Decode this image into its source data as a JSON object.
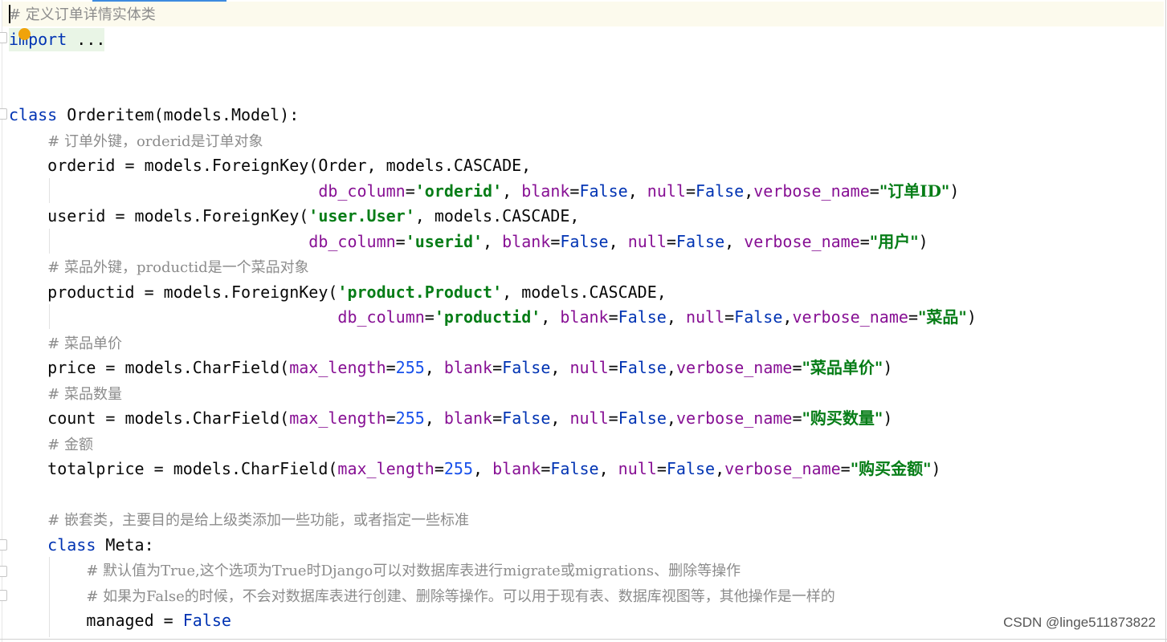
{
  "code": {
    "lines": [
      {
        "tokens": [
          {
            "t": "cmt",
            "v": "# 定义订单详情实体类"
          }
        ]
      },
      {
        "tokens": [
          {
            "t": "kw",
            "v": "import"
          },
          {
            "t": "txt",
            "v": " ..."
          }
        ]
      },
      {
        "tokens": []
      },
      {
        "tokens": []
      },
      {
        "tokens": [
          {
            "t": "kw",
            "v": "class"
          },
          {
            "t": "txt",
            "v": " Orderitem(models.Model):"
          }
        ]
      },
      {
        "tokens": [
          {
            "t": "txt",
            "v": "    "
          },
          {
            "t": "cmt",
            "v": "# 订单外键，orderid是订单对象"
          }
        ]
      },
      {
        "tokens": [
          {
            "t": "txt",
            "v": "    orderid = models.ForeignKey(Order, models.CASCADE,"
          }
        ]
      },
      {
        "tokens": [
          {
            "t": "txt",
            "v": "                                "
          },
          {
            "t": "param",
            "v": "db_column"
          },
          {
            "t": "txt",
            "v": "="
          },
          {
            "t": "str",
            "v": "'orderid'"
          },
          {
            "t": "txt",
            "v": ", "
          },
          {
            "t": "param",
            "v": "blank"
          },
          {
            "t": "txt",
            "v": "="
          },
          {
            "t": "kw",
            "v": "False"
          },
          {
            "t": "txt",
            "v": ", "
          },
          {
            "t": "param",
            "v": "null"
          },
          {
            "t": "txt",
            "v": "="
          },
          {
            "t": "kw",
            "v": "False"
          },
          {
            "t": "txt",
            "v": ","
          },
          {
            "t": "param",
            "v": "verbose_name"
          },
          {
            "t": "txt",
            "v": "="
          },
          {
            "t": "str",
            "v": "\"订单ID\""
          },
          {
            "t": "txt",
            "v": ")"
          }
        ]
      },
      {
        "tokens": [
          {
            "t": "txt",
            "v": "    userid = models.ForeignKey("
          },
          {
            "t": "str",
            "v": "'user.User'"
          },
          {
            "t": "txt",
            "v": ", models.CASCADE,"
          }
        ]
      },
      {
        "tokens": [
          {
            "t": "txt",
            "v": "                               "
          },
          {
            "t": "param",
            "v": "db_column"
          },
          {
            "t": "txt",
            "v": "="
          },
          {
            "t": "str",
            "v": "'userid'"
          },
          {
            "t": "txt",
            "v": ", "
          },
          {
            "t": "param",
            "v": "blank"
          },
          {
            "t": "txt",
            "v": "="
          },
          {
            "t": "kw",
            "v": "False"
          },
          {
            "t": "txt",
            "v": ", "
          },
          {
            "t": "param",
            "v": "null"
          },
          {
            "t": "txt",
            "v": "="
          },
          {
            "t": "kw",
            "v": "False"
          },
          {
            "t": "txt",
            "v": ", "
          },
          {
            "t": "param",
            "v": "verbose_name"
          },
          {
            "t": "txt",
            "v": "="
          },
          {
            "t": "str",
            "v": "\"用户\""
          },
          {
            "t": "txt",
            "v": ")"
          }
        ]
      },
      {
        "tokens": [
          {
            "t": "txt",
            "v": "    "
          },
          {
            "t": "cmt",
            "v": "# 菜品外键，productid是一个菜品对象"
          }
        ]
      },
      {
        "tokens": [
          {
            "t": "txt",
            "v": "    productid = models.ForeignKey("
          },
          {
            "t": "str",
            "v": "'product.Product'"
          },
          {
            "t": "txt",
            "v": ", models.CASCADE,"
          }
        ]
      },
      {
        "tokens": [
          {
            "t": "txt",
            "v": "                                  "
          },
          {
            "t": "param",
            "v": "db_column"
          },
          {
            "t": "txt",
            "v": "="
          },
          {
            "t": "str",
            "v": "'productid'"
          },
          {
            "t": "txt",
            "v": ", "
          },
          {
            "t": "param",
            "v": "blank"
          },
          {
            "t": "txt",
            "v": "="
          },
          {
            "t": "kw",
            "v": "False"
          },
          {
            "t": "txt",
            "v": ", "
          },
          {
            "t": "param",
            "v": "null"
          },
          {
            "t": "txt",
            "v": "="
          },
          {
            "t": "kw",
            "v": "False"
          },
          {
            "t": "txt",
            "v": ","
          },
          {
            "t": "param",
            "v": "verbose_name"
          },
          {
            "t": "txt",
            "v": "="
          },
          {
            "t": "str",
            "v": "\"菜品\""
          },
          {
            "t": "txt",
            "v": ")"
          }
        ]
      },
      {
        "tokens": [
          {
            "t": "txt",
            "v": "    "
          },
          {
            "t": "cmt",
            "v": "# 菜品单价"
          }
        ]
      },
      {
        "tokens": [
          {
            "t": "txt",
            "v": "    price = models.CharField("
          },
          {
            "t": "param",
            "v": "max_length"
          },
          {
            "t": "txt",
            "v": "="
          },
          {
            "t": "num",
            "v": "255"
          },
          {
            "t": "txt",
            "v": ", "
          },
          {
            "t": "param",
            "v": "blank"
          },
          {
            "t": "txt",
            "v": "="
          },
          {
            "t": "kw",
            "v": "False"
          },
          {
            "t": "txt",
            "v": ", "
          },
          {
            "t": "param",
            "v": "null"
          },
          {
            "t": "txt",
            "v": "="
          },
          {
            "t": "kw",
            "v": "False"
          },
          {
            "t": "txt",
            "v": ","
          },
          {
            "t": "param",
            "v": "verbose_name"
          },
          {
            "t": "txt",
            "v": "="
          },
          {
            "t": "str",
            "v": "\"菜品单价\""
          },
          {
            "t": "txt",
            "v": ")"
          }
        ]
      },
      {
        "tokens": [
          {
            "t": "txt",
            "v": "    "
          },
          {
            "t": "cmt",
            "v": "# 菜品数量"
          }
        ]
      },
      {
        "tokens": [
          {
            "t": "txt",
            "v": "    count = models.CharField("
          },
          {
            "t": "param",
            "v": "max_length"
          },
          {
            "t": "txt",
            "v": "="
          },
          {
            "t": "num",
            "v": "255"
          },
          {
            "t": "txt",
            "v": ", "
          },
          {
            "t": "param",
            "v": "blank"
          },
          {
            "t": "txt",
            "v": "="
          },
          {
            "t": "kw",
            "v": "False"
          },
          {
            "t": "txt",
            "v": ", "
          },
          {
            "t": "param",
            "v": "null"
          },
          {
            "t": "txt",
            "v": "="
          },
          {
            "t": "kw",
            "v": "False"
          },
          {
            "t": "txt",
            "v": ","
          },
          {
            "t": "param",
            "v": "verbose_name"
          },
          {
            "t": "txt",
            "v": "="
          },
          {
            "t": "str",
            "v": "\"购买数量\""
          },
          {
            "t": "txt",
            "v": ")"
          }
        ]
      },
      {
        "tokens": [
          {
            "t": "txt",
            "v": "    "
          },
          {
            "t": "cmt",
            "v": "# 金额"
          }
        ]
      },
      {
        "tokens": [
          {
            "t": "txt",
            "v": "    totalprice = models.CharField("
          },
          {
            "t": "param",
            "v": "max_length"
          },
          {
            "t": "txt",
            "v": "="
          },
          {
            "t": "num",
            "v": "255"
          },
          {
            "t": "txt",
            "v": ", "
          },
          {
            "t": "param",
            "v": "blank"
          },
          {
            "t": "txt",
            "v": "="
          },
          {
            "t": "kw",
            "v": "False"
          },
          {
            "t": "txt",
            "v": ", "
          },
          {
            "t": "param",
            "v": "null"
          },
          {
            "t": "txt",
            "v": "="
          },
          {
            "t": "kw",
            "v": "False"
          },
          {
            "t": "txt",
            "v": ","
          },
          {
            "t": "param",
            "v": "verbose_name"
          },
          {
            "t": "txt",
            "v": "="
          },
          {
            "t": "str",
            "v": "\"购买金额\""
          },
          {
            "t": "txt",
            "v": ")"
          }
        ]
      },
      {
        "tokens": []
      },
      {
        "tokens": [
          {
            "t": "txt",
            "v": "    "
          },
          {
            "t": "cmt",
            "v": "# 嵌套类，主要目的是给上级类添加一些功能，或者指定一些标准"
          }
        ]
      },
      {
        "tokens": [
          {
            "t": "txt",
            "v": "    "
          },
          {
            "t": "kw",
            "v": "class"
          },
          {
            "t": "txt",
            "v": " Meta:"
          }
        ]
      },
      {
        "tokens": [
          {
            "t": "txt",
            "v": "        "
          },
          {
            "t": "cmt",
            "v": "# 默认值为True,这个选项为True时Django可以对数据库表进行migrate或migrations、删除等操作"
          }
        ]
      },
      {
        "tokens": [
          {
            "t": "txt",
            "v": "        "
          },
          {
            "t": "cmt",
            "v": "# 如果为False的时候，不会对数据库表进行创建、删除等操作。可以用于现有表、数据库视图等，其他操作是一样的"
          }
        ]
      },
      {
        "tokens": [
          {
            "t": "txt",
            "v": "        managed = "
          },
          {
            "t": "kw",
            "v": "False"
          }
        ]
      }
    ]
  },
  "watermark": "CSDN @linge511873822",
  "colors": {
    "keyword": "#0033b3",
    "string": "#067d17",
    "param": "#871094",
    "comment": "#8c8c8c",
    "number": "#1750eb",
    "caret_line": "#fcfaed",
    "folded_region": "#e9f5e6",
    "bulb": "#f0a30a"
  }
}
